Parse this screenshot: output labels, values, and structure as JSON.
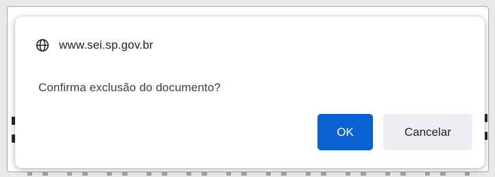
{
  "dialog": {
    "origin": "www.sei.sp.gov.br",
    "message": "Confirma exclusão do documento?",
    "ok_label": "OK",
    "cancel_label": "Cancelar",
    "origin_icon": "globe-icon",
    "accent_color": "#0b63d1"
  }
}
